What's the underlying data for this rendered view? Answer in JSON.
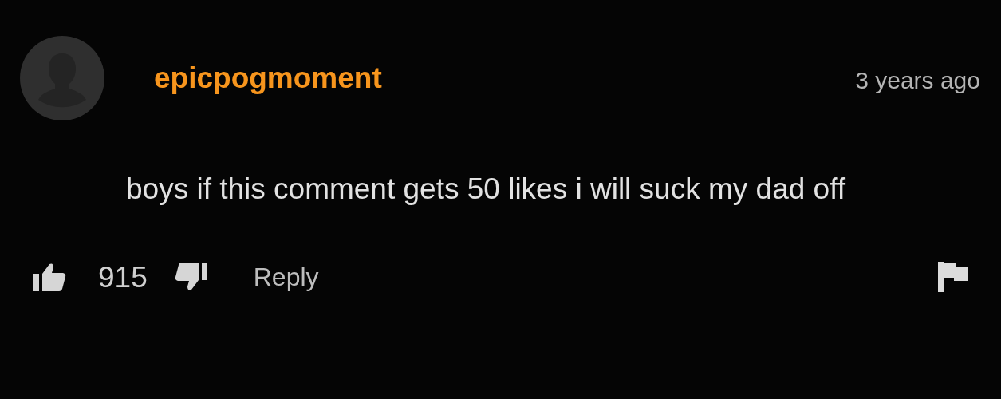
{
  "comment": {
    "author": "epicpogmoment",
    "time": "3 years ago",
    "text": "boys if this comment gets 50 likes i will suck my dad off",
    "likes": "915",
    "reply_label": "Reply"
  }
}
